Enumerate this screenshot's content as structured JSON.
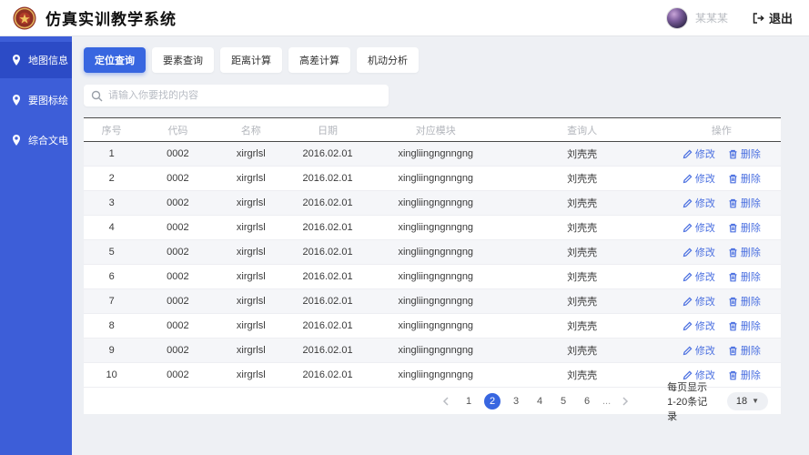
{
  "header": {
    "title": "仿真实训教学系统",
    "logo_icon": "emblem-badge-icon",
    "user_name": "某某某",
    "logout_label": "退出"
  },
  "sidebar": {
    "items": [
      {
        "label": "地图信息",
        "icon": "map-pin-icon",
        "active": true
      },
      {
        "label": "要图标绘",
        "icon": "pen-draw-icon",
        "active": false
      },
      {
        "label": "综合文电",
        "icon": "document-icon",
        "active": false
      }
    ]
  },
  "tabs": [
    {
      "label": "定位查询",
      "active": true
    },
    {
      "label": "要素查询",
      "active": false
    },
    {
      "label": "距离计算",
      "active": false
    },
    {
      "label": "高差计算",
      "active": false
    },
    {
      "label": "机动分析",
      "active": false
    }
  ],
  "search": {
    "placeholder": "请输入你要找的内容",
    "icon": "search-icon"
  },
  "table": {
    "columns": [
      "序号",
      "代码",
      "名称",
      "日期",
      "对应模块",
      "查询人",
      "操作"
    ],
    "actions": {
      "edit": "修改",
      "delete": "删除"
    },
    "rows": [
      {
        "seq": "1",
        "code": "0002",
        "name": "xirgrlsl",
        "date": "2016.02.01",
        "module": "xingliingngnngng",
        "person": "刘壳壳"
      },
      {
        "seq": "2",
        "code": "0002",
        "name": "xirgrlsl",
        "date": "2016.02.01",
        "module": "xingliingngnngng",
        "person": "刘壳壳"
      },
      {
        "seq": "3",
        "code": "0002",
        "name": "xirgrlsl",
        "date": "2016.02.01",
        "module": "xingliingngnngng",
        "person": "刘壳壳"
      },
      {
        "seq": "4",
        "code": "0002",
        "name": "xirgrlsl",
        "date": "2016.02.01",
        "module": "xingliingngnngng",
        "person": "刘壳壳"
      },
      {
        "seq": "5",
        "code": "0002",
        "name": "xirgrlsl",
        "date": "2016.02.01",
        "module": "xingliingngnngng",
        "person": "刘壳壳"
      },
      {
        "seq": "6",
        "code": "0002",
        "name": "xirgrlsl",
        "date": "2016.02.01",
        "module": "xingliingngnngng",
        "person": "刘壳壳"
      },
      {
        "seq": "7",
        "code": "0002",
        "name": "xirgrlsl",
        "date": "2016.02.01",
        "module": "xingliingngnngng",
        "person": "刘壳壳"
      },
      {
        "seq": "8",
        "code": "0002",
        "name": "xirgrlsl",
        "date": "2016.02.01",
        "module": "xingliingngnngng",
        "person": "刘壳壳"
      },
      {
        "seq": "9",
        "code": "0002",
        "name": "xirgrlsl",
        "date": "2016.02.01",
        "module": "xingliingngnngng",
        "person": "刘壳壳"
      },
      {
        "seq": "10",
        "code": "0002",
        "name": "xirgrlsl",
        "date": "2016.02.01",
        "module": "xingliingngnngng",
        "person": "刘壳壳"
      }
    ]
  },
  "pagination": {
    "pages": [
      {
        "label": "1",
        "active": false
      },
      {
        "label": "2",
        "active": true
      },
      {
        "label": "3",
        "active": false
      },
      {
        "label": "4",
        "active": false
      },
      {
        "label": "5",
        "active": false
      },
      {
        "label": "6",
        "active": false
      }
    ],
    "ellipsis": "...",
    "summary": "每页显示1-20条记录",
    "page_size": "18"
  },
  "colors": {
    "sidebar": "#3d5ed8",
    "sidebar_active": "#2c4bc6",
    "accent_blue": "#3866e0",
    "action_link": "#4a6fe0",
    "content_bg": "#eef0f4"
  }
}
